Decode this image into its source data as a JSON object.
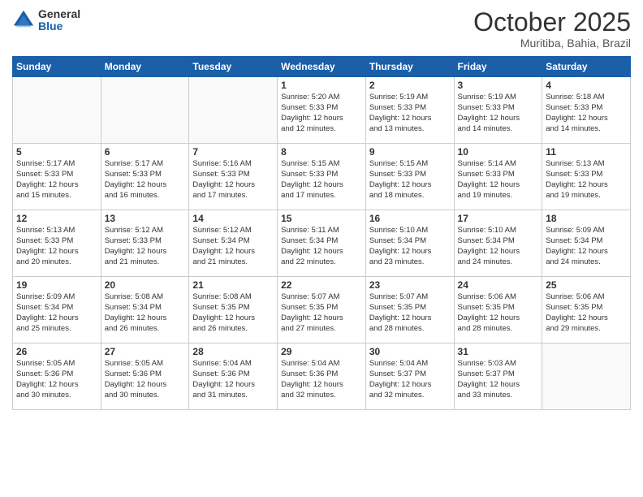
{
  "header": {
    "logo_general": "General",
    "logo_blue": "Blue",
    "month": "October 2025",
    "location": "Muritiba, Bahia, Brazil"
  },
  "weekdays": [
    "Sunday",
    "Monday",
    "Tuesday",
    "Wednesday",
    "Thursday",
    "Friday",
    "Saturday"
  ],
  "weeks": [
    [
      {
        "day": "",
        "info": ""
      },
      {
        "day": "",
        "info": ""
      },
      {
        "day": "",
        "info": ""
      },
      {
        "day": "1",
        "info": "Sunrise: 5:20 AM\nSunset: 5:33 PM\nDaylight: 12 hours\nand 12 minutes."
      },
      {
        "day": "2",
        "info": "Sunrise: 5:19 AM\nSunset: 5:33 PM\nDaylight: 12 hours\nand 13 minutes."
      },
      {
        "day": "3",
        "info": "Sunrise: 5:19 AM\nSunset: 5:33 PM\nDaylight: 12 hours\nand 14 minutes."
      },
      {
        "day": "4",
        "info": "Sunrise: 5:18 AM\nSunset: 5:33 PM\nDaylight: 12 hours\nand 14 minutes."
      }
    ],
    [
      {
        "day": "5",
        "info": "Sunrise: 5:17 AM\nSunset: 5:33 PM\nDaylight: 12 hours\nand 15 minutes."
      },
      {
        "day": "6",
        "info": "Sunrise: 5:17 AM\nSunset: 5:33 PM\nDaylight: 12 hours\nand 16 minutes."
      },
      {
        "day": "7",
        "info": "Sunrise: 5:16 AM\nSunset: 5:33 PM\nDaylight: 12 hours\nand 17 minutes."
      },
      {
        "day": "8",
        "info": "Sunrise: 5:15 AM\nSunset: 5:33 PM\nDaylight: 12 hours\nand 17 minutes."
      },
      {
        "day": "9",
        "info": "Sunrise: 5:15 AM\nSunset: 5:33 PM\nDaylight: 12 hours\nand 18 minutes."
      },
      {
        "day": "10",
        "info": "Sunrise: 5:14 AM\nSunset: 5:33 PM\nDaylight: 12 hours\nand 19 minutes."
      },
      {
        "day": "11",
        "info": "Sunrise: 5:13 AM\nSunset: 5:33 PM\nDaylight: 12 hours\nand 19 minutes."
      }
    ],
    [
      {
        "day": "12",
        "info": "Sunrise: 5:13 AM\nSunset: 5:33 PM\nDaylight: 12 hours\nand 20 minutes."
      },
      {
        "day": "13",
        "info": "Sunrise: 5:12 AM\nSunset: 5:33 PM\nDaylight: 12 hours\nand 21 minutes."
      },
      {
        "day": "14",
        "info": "Sunrise: 5:12 AM\nSunset: 5:34 PM\nDaylight: 12 hours\nand 21 minutes."
      },
      {
        "day": "15",
        "info": "Sunrise: 5:11 AM\nSunset: 5:34 PM\nDaylight: 12 hours\nand 22 minutes."
      },
      {
        "day": "16",
        "info": "Sunrise: 5:10 AM\nSunset: 5:34 PM\nDaylight: 12 hours\nand 23 minutes."
      },
      {
        "day": "17",
        "info": "Sunrise: 5:10 AM\nSunset: 5:34 PM\nDaylight: 12 hours\nand 24 minutes."
      },
      {
        "day": "18",
        "info": "Sunrise: 5:09 AM\nSunset: 5:34 PM\nDaylight: 12 hours\nand 24 minutes."
      }
    ],
    [
      {
        "day": "19",
        "info": "Sunrise: 5:09 AM\nSunset: 5:34 PM\nDaylight: 12 hours\nand 25 minutes."
      },
      {
        "day": "20",
        "info": "Sunrise: 5:08 AM\nSunset: 5:34 PM\nDaylight: 12 hours\nand 26 minutes."
      },
      {
        "day": "21",
        "info": "Sunrise: 5:08 AM\nSunset: 5:35 PM\nDaylight: 12 hours\nand 26 minutes."
      },
      {
        "day": "22",
        "info": "Sunrise: 5:07 AM\nSunset: 5:35 PM\nDaylight: 12 hours\nand 27 minutes."
      },
      {
        "day": "23",
        "info": "Sunrise: 5:07 AM\nSunset: 5:35 PM\nDaylight: 12 hours\nand 28 minutes."
      },
      {
        "day": "24",
        "info": "Sunrise: 5:06 AM\nSunset: 5:35 PM\nDaylight: 12 hours\nand 28 minutes."
      },
      {
        "day": "25",
        "info": "Sunrise: 5:06 AM\nSunset: 5:35 PM\nDaylight: 12 hours\nand 29 minutes."
      }
    ],
    [
      {
        "day": "26",
        "info": "Sunrise: 5:05 AM\nSunset: 5:36 PM\nDaylight: 12 hours\nand 30 minutes."
      },
      {
        "day": "27",
        "info": "Sunrise: 5:05 AM\nSunset: 5:36 PM\nDaylight: 12 hours\nand 30 minutes."
      },
      {
        "day": "28",
        "info": "Sunrise: 5:04 AM\nSunset: 5:36 PM\nDaylight: 12 hours\nand 31 minutes."
      },
      {
        "day": "29",
        "info": "Sunrise: 5:04 AM\nSunset: 5:36 PM\nDaylight: 12 hours\nand 32 minutes."
      },
      {
        "day": "30",
        "info": "Sunrise: 5:04 AM\nSunset: 5:37 PM\nDaylight: 12 hours\nand 32 minutes."
      },
      {
        "day": "31",
        "info": "Sunrise: 5:03 AM\nSunset: 5:37 PM\nDaylight: 12 hours\nand 33 minutes."
      },
      {
        "day": "",
        "info": ""
      }
    ]
  ]
}
